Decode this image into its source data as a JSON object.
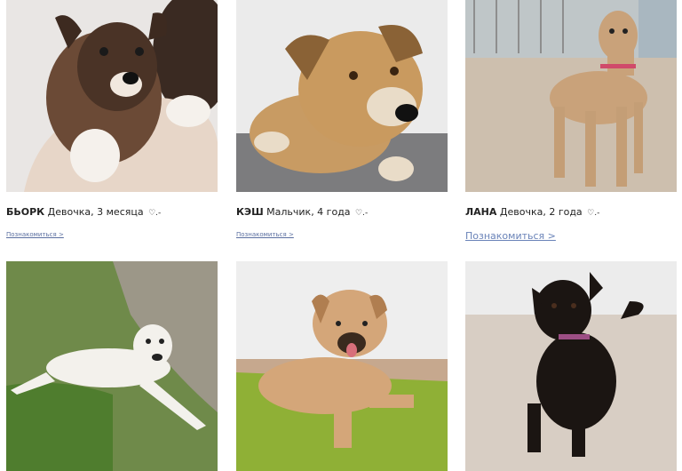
{
  "cards": [
    {
      "name": "БЬОРК",
      "desc": " Девочка, 3 месяца ",
      "heart": "♡.-",
      "link": "Познакомиться >"
    },
    {
      "name": "КЭШ",
      "desc": " Мальчик, 4 года ",
      "heart": "♡.-",
      "link": "Познакомиться >"
    },
    {
      "name": "ЛАНА",
      "desc": " Девочка, 2 года ",
      "heart": "♡.-",
      "link": "Познакомиться >"
    },
    {},
    {},
    {}
  ],
  "colors": {
    "link": "#5b6fa0",
    "link_hover": "#6a83b8",
    "text": "#222222"
  }
}
